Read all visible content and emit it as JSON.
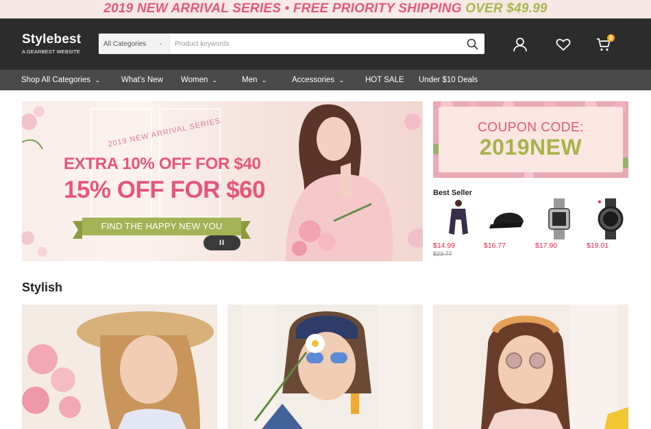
{
  "promo": {
    "part1": "2019 NEW ARRIVAL SERIES • FREE PRIORITY SHIPPING",
    "part2": "OVER $49.99"
  },
  "header": {
    "logo_name": "Stylebest",
    "logo_sub": "A GEARBEST WEBSITE",
    "category_select": "All Categories",
    "search_placeholder": "Product keywords",
    "cart_count": "0"
  },
  "nav": {
    "items": [
      {
        "label": "Shop All Categories",
        "dropdown": true
      },
      {
        "label": "What's New",
        "dropdown": false
      },
      {
        "label": "Women",
        "dropdown": true
      },
      {
        "label": "Men",
        "dropdown": true
      },
      {
        "label": "Accessories",
        "dropdown": true
      },
      {
        "label": "HOT SALE",
        "dropdown": false
      },
      {
        "label": "Under $10 Deals",
        "dropdown": false
      }
    ]
  },
  "hero": {
    "arc_text": "2019 NEW ARRIVAL SERIES",
    "line1": "EXTRA 10% OFF FOR $40",
    "line2": "15% OFF FOR $60",
    "ribbon": "FIND THE HAPPY NEW YOU",
    "pause": "II"
  },
  "coupon": {
    "line1": "COUPON CODE:",
    "line2": "2019NEW"
  },
  "best_seller": {
    "title": "Best Seller",
    "items": [
      {
        "price": "$14.99",
        "old_price": "$23.77",
        "image": "blouse"
      },
      {
        "price": "$16.77",
        "old_price": "",
        "image": "cap"
      },
      {
        "price": "$17.90",
        "old_price": "",
        "image": "watch-silver"
      },
      {
        "price": "$19.01",
        "old_price": "",
        "image": "watch-black"
      }
    ]
  },
  "stylish": {
    "title": "Stylish"
  },
  "colors": {
    "accent_pink": "#e8557c",
    "accent_green": "#a4b355",
    "price_red": "#e4224c",
    "header_bg": "#2c2c2c",
    "nav_bg": "#4a4a4a"
  }
}
